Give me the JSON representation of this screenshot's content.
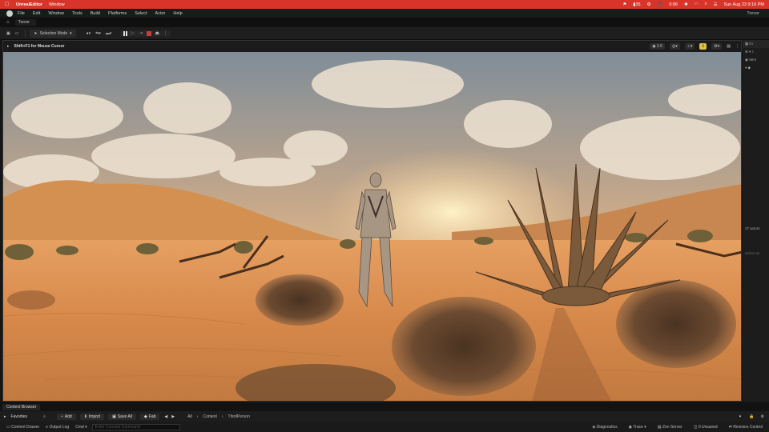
{
  "mac_menu": {
    "app": "UnrealEditor",
    "items": [
      "Window"
    ],
    "battery": "35",
    "time_badge": "0:06",
    "datetime": "Sun Aug 23  9:16 PM"
  },
  "editor_menu": {
    "items": [
      "File",
      "Edit",
      "Window",
      "Tools",
      "Build",
      "Platforms",
      "Select",
      "Actor",
      "Help"
    ],
    "project": "Trevor"
  },
  "tab": {
    "label": "Trevor"
  },
  "toolbar": {
    "selection_mode": "Selection Mode"
  },
  "viewport": {
    "hint": "Shift+F1 for Mouse Cursor",
    "scale_chip": "1.5",
    "camera_speed": "1"
  },
  "outliner": {
    "header": "0 /",
    "column": "Item",
    "actors_count": "27 actors",
    "select_hint": "Select an"
  },
  "content_browser": {
    "tab": "Content Browser",
    "favorites": "Favorites",
    "add": "Add",
    "import": "Import",
    "save_all": "Save All",
    "fab": "Fab",
    "path": [
      "All",
      "Content",
      "ThirdPerson"
    ]
  },
  "status_bar": {
    "content_drawer": "Content Drawer",
    "output_log": "Output Log",
    "cmd": "Cmd",
    "console_placeholder": "Enter Console Command",
    "diagnostics": "Diagnostics",
    "trace": "Trace",
    "zen_server": "Zen Server",
    "unsaved": "0 Unsaved",
    "revision": "Revision Control"
  },
  "colors": {
    "mac_bar": "#d8342a",
    "sky_top": "#7a8fa0",
    "sand": "#d08a4a"
  }
}
